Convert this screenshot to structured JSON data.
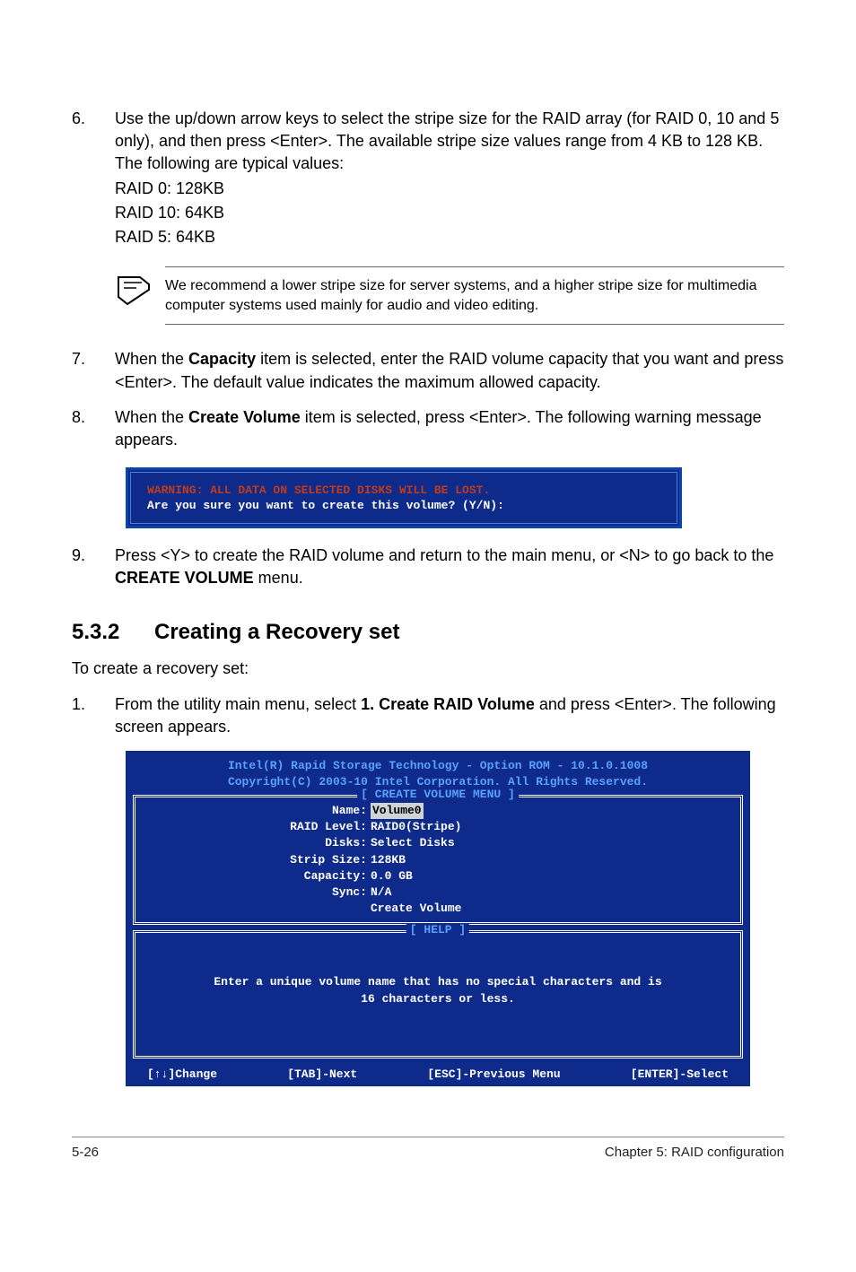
{
  "step6": {
    "num": "6.",
    "text": "Use the up/down arrow keys to select the stripe size for the RAID array (for RAID 0, 10 and 5 only), and then press <Enter>. The available stripe size values range from 4 KB to 128 KB. The following are typical values:",
    "l1": "RAID 0: 128KB",
    "l2": "RAID 10: 64KB",
    "l3": "RAID 5: 64KB"
  },
  "note": "We recommend a lower stripe size for server systems, and a higher stripe size for multimedia computer systems used mainly for audio and video editing.",
  "step7": {
    "num": "7.",
    "pre": "When the ",
    "bold": "Capacity",
    "post": " item is selected, enter the RAID volume capacity that you want and press <Enter>. The default value indicates the maximum allowed capacity."
  },
  "step8": {
    "num": "8.",
    "pre": "When the ",
    "bold": "Create Volume",
    "post": " item is selected, press <Enter>. The following warning message appears."
  },
  "warnbox": {
    "l1": "WARNING: ALL DATA ON SELECTED DISKS WILL BE LOST.",
    "l2": "Are you sure you want to create this volume? (Y/N):"
  },
  "step9": {
    "num": "9.",
    "pre": "Press <Y> to create the RAID volume and return to the main menu, or <N> to go back to the ",
    "bold": "CREATE VOLUME",
    "post": " menu."
  },
  "section": {
    "num": "5.3.2",
    "title": "Creating a Recovery set"
  },
  "intro": "To create a recovery set:",
  "step1": {
    "num": "1.",
    "pre": "From the utility main menu, select ",
    "bold": "1. Create RAID Volume",
    "post": " and press <Enter>. The following screen appears."
  },
  "bios": {
    "title1": "Intel(R) Rapid Storage Technology - Option ROM - 10.1.0.1008",
    "title2": "Copyright(C) 2003-10 Intel Corporation.  All Rights Reserved.",
    "panel1_label": "[ CREATE VOLUME MENU ]",
    "rows": [
      {
        "k": "Name:",
        "v": "Volume0",
        "inv": true
      },
      {
        "k": "RAID Level:",
        "v": "RAID0(Stripe)"
      },
      {
        "k": "Disks:",
        "v": "Select Disks"
      },
      {
        "k": "Strip Size:",
        "v": " 128KB"
      },
      {
        "k": "Capacity:",
        "v": "0.0   GB"
      },
      {
        "k": "Sync:",
        "v": "N/A"
      },
      {
        "k": "",
        "v": "Create Volume"
      }
    ],
    "panel2_label": "[ HELP ]",
    "help1": "Enter a unique volume name that has no special characters and is",
    "help2": "16 characters or less.",
    "f1": "[↑↓]Change",
    "f2": "[TAB]-Next",
    "f3": "[ESC]-Previous Menu",
    "f4": "[ENTER]-Select"
  },
  "footer": {
    "left": "5-26",
    "right": "Chapter 5: RAID configuration"
  }
}
